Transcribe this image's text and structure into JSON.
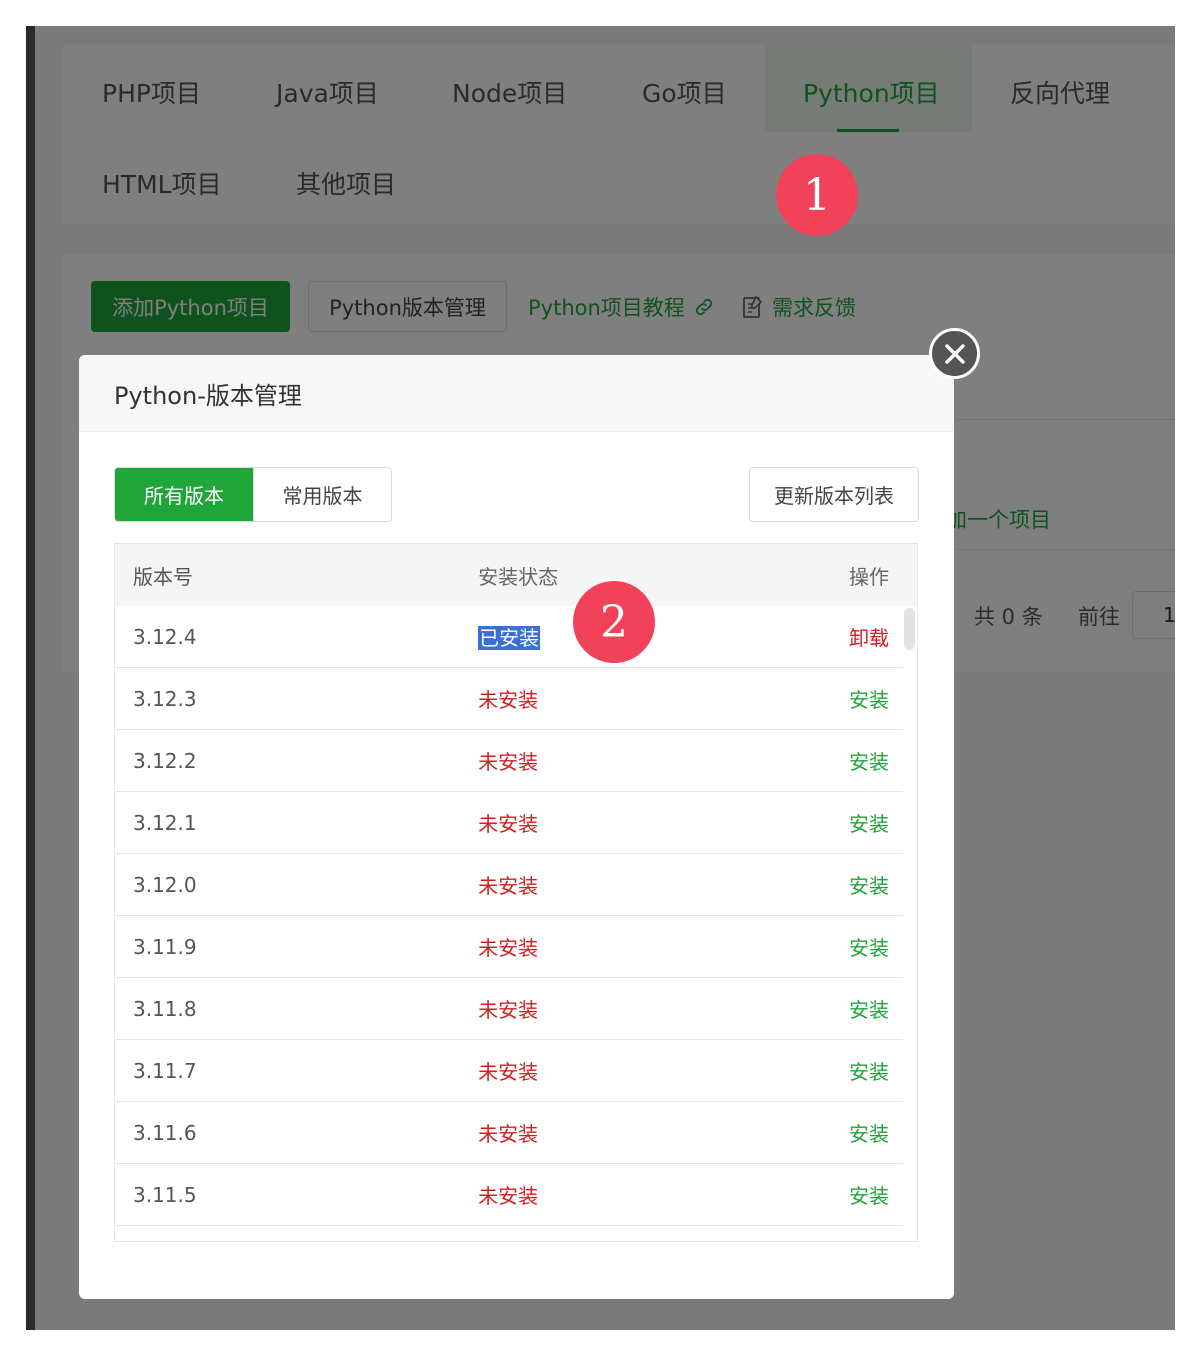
{
  "tabs": [
    {
      "label": "PHP项目"
    },
    {
      "label": "Java项目"
    },
    {
      "label": "Node项目"
    },
    {
      "label": "Go项目"
    },
    {
      "label": "Python项目",
      "active": true
    },
    {
      "label": "反向代理"
    },
    {
      "label": "HTML项目"
    },
    {
      "label": "其他项目"
    }
  ],
  "toolbar": {
    "add_label": "添加Python项目",
    "version_mgmt_label": "Python版本管理",
    "tutorial_label": "Python项目教程",
    "feedback_label": "需求反馈"
  },
  "background": {
    "add_project_hint": "加一个项目",
    "total": "共 0 条",
    "goto": "前往",
    "page_value": "1"
  },
  "modal": {
    "title": "Python-版本管理",
    "seg_all": "所有版本",
    "seg_common": "常用版本",
    "refresh_label": "更新版本列表",
    "columns": {
      "version": "版本号",
      "status": "安装状态",
      "action": "操作"
    },
    "rows": [
      {
        "version": "3.12.4",
        "status": "已安装",
        "action": "卸载"
      },
      {
        "version": "3.12.3",
        "status": "未安装",
        "action": "安装"
      },
      {
        "version": "3.12.2",
        "status": "未安装",
        "action": "安装"
      },
      {
        "version": "3.12.1",
        "status": "未安装",
        "action": "安装"
      },
      {
        "version": "3.12.0",
        "status": "未安装",
        "action": "安装"
      },
      {
        "version": "3.11.9",
        "status": "未安装",
        "action": "安装"
      },
      {
        "version": "3.11.8",
        "status": "未安装",
        "action": "安装"
      },
      {
        "version": "3.11.7",
        "status": "未安装",
        "action": "安装"
      },
      {
        "version": "3.11.6",
        "status": "未安装",
        "action": "安装"
      },
      {
        "version": "3.11.5",
        "status": "未安装",
        "action": "安装"
      }
    ]
  },
  "annotations": {
    "one": "1",
    "two": "2"
  },
  "colors": {
    "accent": "#20a53a",
    "danger": "#d11f1f",
    "badge": "#f2425a"
  }
}
